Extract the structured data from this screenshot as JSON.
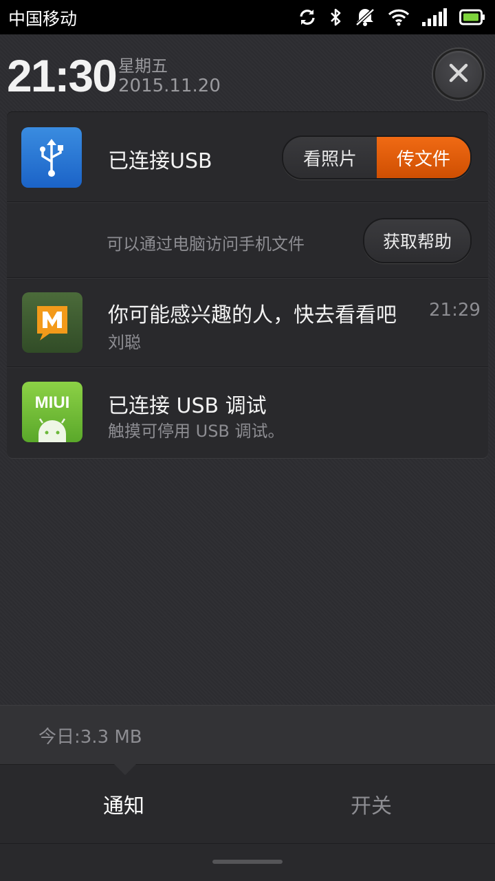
{
  "status_bar": {
    "carrier": "中国移动",
    "icons": [
      "sync-icon",
      "bluetooth-icon",
      "mute-icon",
      "wifi-icon",
      "signal-icon",
      "battery-icon"
    ]
  },
  "header": {
    "time": "21:30",
    "weekday": "星期五",
    "date": "2015.11.20"
  },
  "usb_notification": {
    "title": "已连接USB",
    "option_photos": "看照片",
    "option_files": "传文件",
    "description": "可以通过电脑访问手机文件",
    "help_button": "获取帮助",
    "accent_color": "#e85d0c"
  },
  "notifications": [
    {
      "title": "你可能感兴趣的人，快去看看吧",
      "subtitle": "刘聪",
      "time": "21:29",
      "icon": "M"
    },
    {
      "title": "已连接 USB 调试",
      "subtitle": "触摸可停用 USB 调试。",
      "icon": "MIUI"
    }
  ],
  "data_usage": "今日:3.3 MB",
  "tabs": {
    "notify": "通知",
    "switches": "开关"
  }
}
